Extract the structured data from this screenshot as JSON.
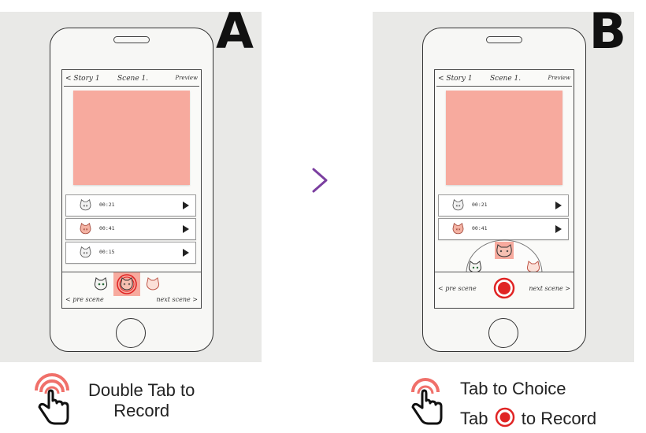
{
  "panels": {
    "a": {
      "letter": "A",
      "header": {
        "back": "< Story 1",
        "scene": "Scene 1.",
        "preview": "Preview"
      },
      "clips": [
        {
          "time": "00:21",
          "cat": "gray"
        },
        {
          "time": "00:41",
          "cat": "pink"
        },
        {
          "time": "00:15",
          "cat": "gray"
        }
      ],
      "nav": {
        "prev": "< pre scene",
        "next": "next scene >"
      },
      "caption": [
        "Double Tab to",
        "Record"
      ]
    },
    "b": {
      "letter": "B",
      "header": {
        "back": "< Story 1",
        "scene": "Scene 1.",
        "preview": "Preview"
      },
      "clips": [
        {
          "time": "00:21",
          "cat": "gray"
        },
        {
          "time": "00:41",
          "cat": "pink"
        }
      ],
      "nav": {
        "prev": "< pre scene",
        "next": "next scene >"
      },
      "caption_line1": "Tab to Choice",
      "caption_line2_pre": "Tab",
      "caption_line2_post": "to Record"
    }
  },
  "colors": {
    "sticky_note": "#f7aa9e",
    "record_red": "#e02424",
    "chevron": "#7b3fa0",
    "tap_ring": "#f0706a"
  },
  "icons": [
    "cat-face-icon",
    "play-icon",
    "record-button-icon",
    "tap-gesture-icon",
    "chevron-right-icon"
  ]
}
